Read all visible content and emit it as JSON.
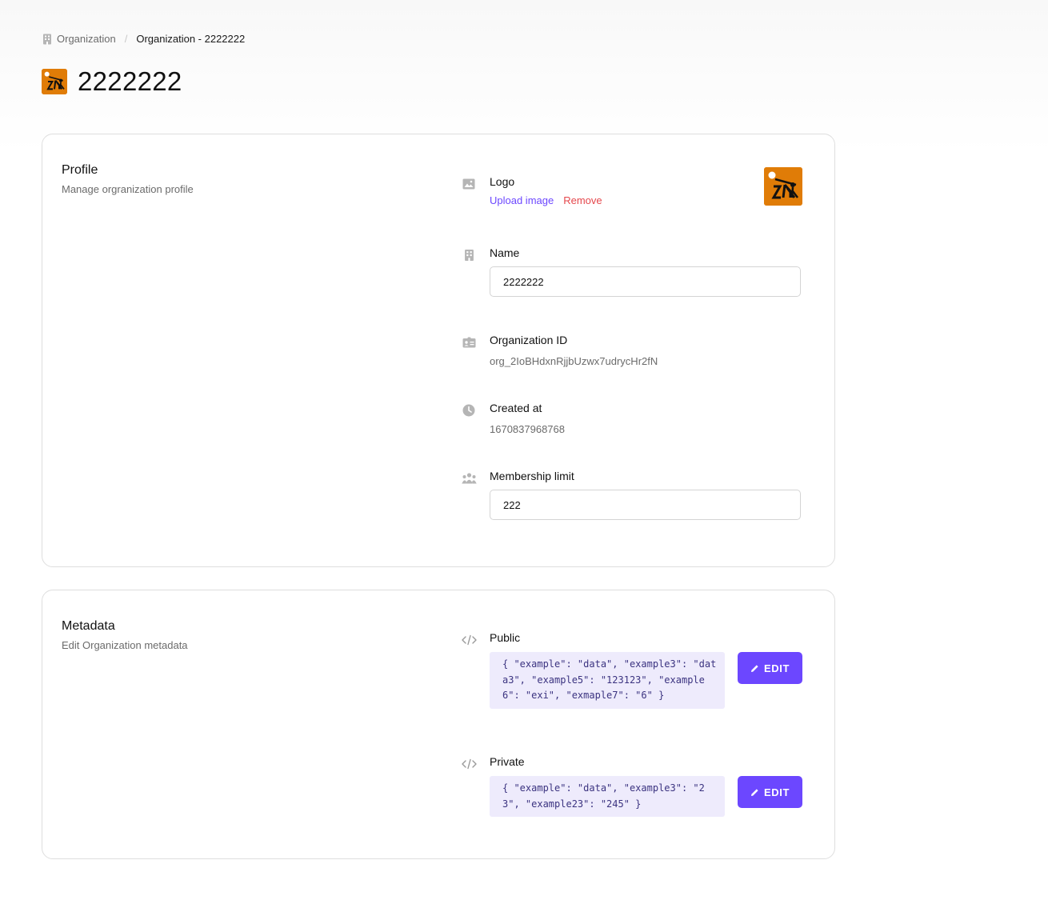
{
  "breadcrumb": {
    "parent_label": "Organization",
    "separator": "/",
    "current_label": "Organization - 2222222"
  },
  "page": {
    "title": "2222222"
  },
  "profile": {
    "title": "Profile",
    "subtitle": "Manage orgranization profile",
    "logo": {
      "label": "Logo",
      "upload_label": "Upload image",
      "remove_label": "Remove"
    },
    "name": {
      "label": "Name",
      "value": "2222222"
    },
    "org_id": {
      "label": "Organization ID",
      "value": "org_2IoBHdxnRjjbUzwx7udrycHr2fN"
    },
    "created_at": {
      "label": "Created at",
      "value": "1670837968768"
    },
    "membership_limit": {
      "label": "Membership limit",
      "value": "222"
    }
  },
  "metadata": {
    "title": "Metadata",
    "subtitle": "Edit Organization metadata",
    "public": {
      "label": "Public",
      "code": "{ \"example\": \"data\", \"example3\": \"data3\", \"example5\": \"123123\", \"example6\": \"exi\", \"exmaple7\": \"6\" }",
      "edit_label": "EDIT"
    },
    "private": {
      "label": "Private",
      "code": "{ \"example\": \"data\", \"example3\": \"23\", \"example23\": \"245\" }",
      "edit_label": "EDIT"
    }
  },
  "colors": {
    "accent": "#6c47ff",
    "danger": "#e5484d",
    "logo_bg": "#e07c07",
    "code_bg": "#eeebfc"
  },
  "icons": {
    "breadcrumb": "building-icon",
    "logo": "image-icon",
    "name": "building-icon",
    "org_id": "id-card-icon",
    "created_at": "clock-icon",
    "membership_limit": "users-icon",
    "code": "code-icon",
    "edit": "pencil-icon"
  }
}
